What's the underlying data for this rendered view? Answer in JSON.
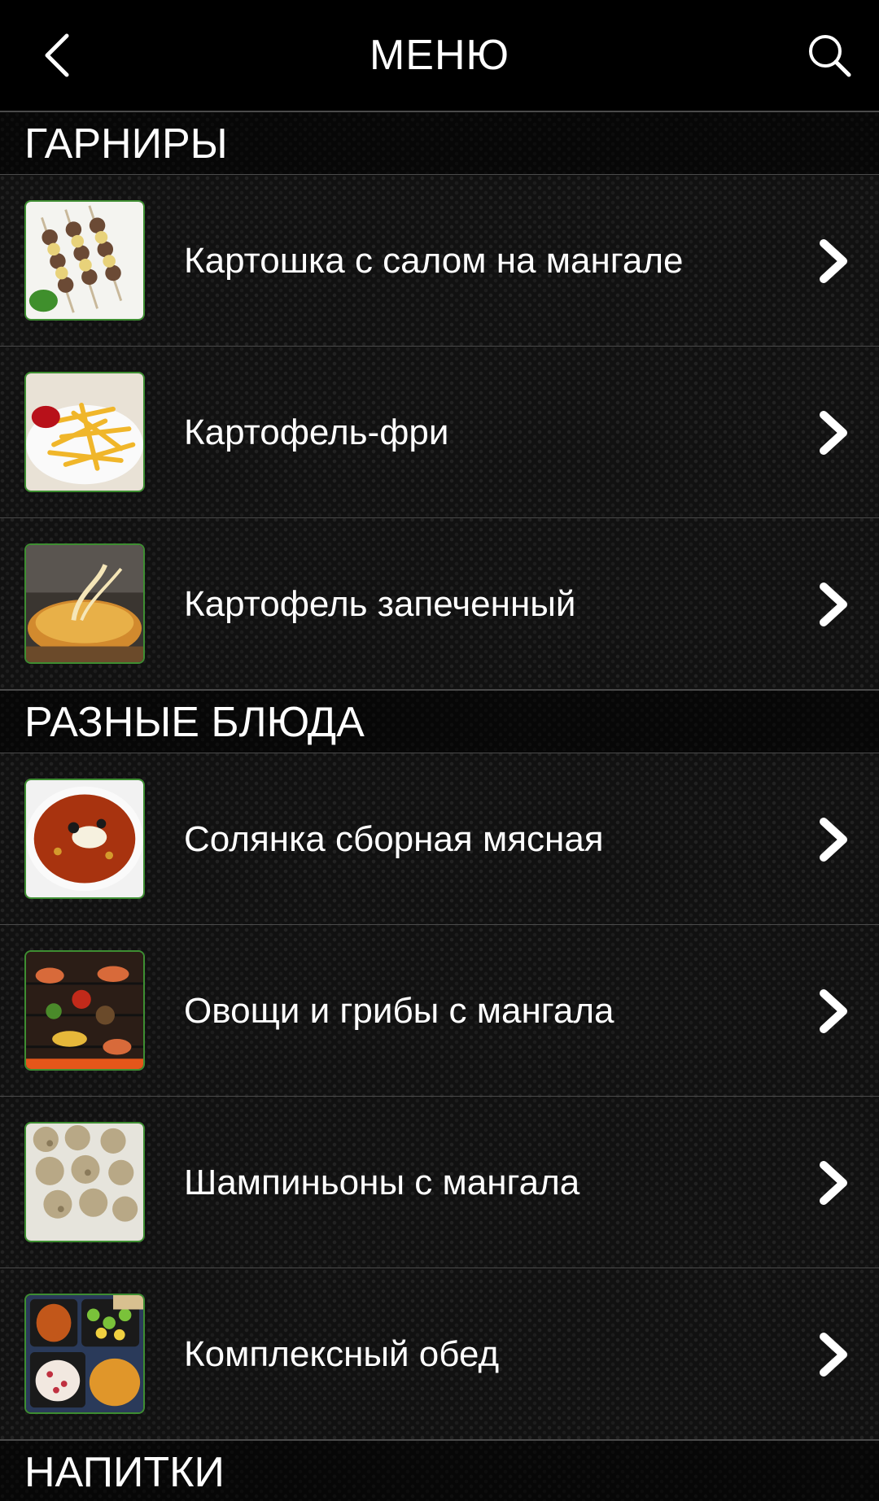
{
  "header": {
    "title": "МЕНЮ",
    "back_icon": "chevron-left-icon",
    "search_icon": "search-icon"
  },
  "sections": [
    {
      "title": "ГАРНИРЫ",
      "items": [
        {
          "label": "Картошка с салом на мангале",
          "image": "potato-skewers-photo"
        },
        {
          "label": "Картофель-фри",
          "image": "french-fries-photo"
        },
        {
          "label": "Картофель запеченный",
          "image": "baked-potato-photo"
        }
      ]
    },
    {
      "title": "РАЗНЫЕ БЛЮДА",
      "items": [
        {
          "label": "Солянка сборная мясная",
          "image": "solyanka-soup-photo"
        },
        {
          "label": "Овощи и грибы с мангала",
          "image": "grilled-vegetables-photo"
        },
        {
          "label": "Шампиньоны с мангала",
          "image": "grilled-mushrooms-photo"
        },
        {
          "label": "Комплексный обед",
          "image": "set-lunch-photo"
        }
      ]
    },
    {
      "title": "НАПИТКИ",
      "items": []
    }
  ],
  "colors": {
    "background": "#111111",
    "topbar": "#000000",
    "thumb_border": "#3e8e32",
    "divider": "#4a4a4a",
    "text": "#ffffff"
  }
}
